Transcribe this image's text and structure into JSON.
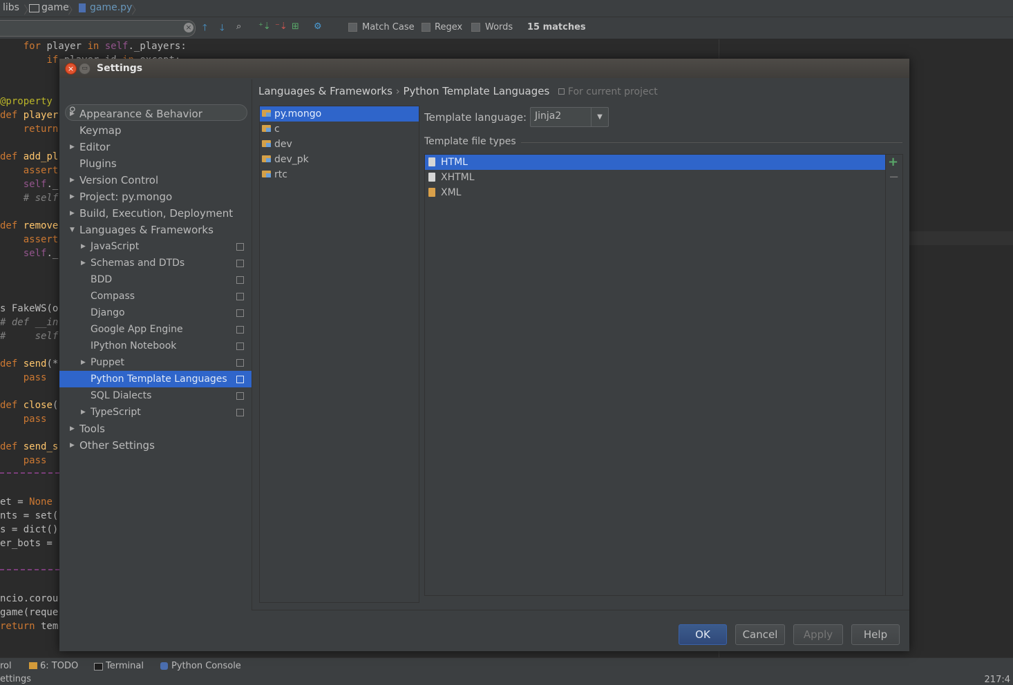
{
  "navbar": {
    "crumbs": [
      "libs",
      "game",
      "game.py"
    ]
  },
  "findbar": {
    "match_case": "Match Case",
    "regex": "Regex",
    "words": "Words",
    "matches": "15 matches"
  },
  "editor": {
    "lines": [
      {
        "t": "    for player in self._players:"
      },
      {
        "t": "        if player_id in except:"
      },
      {
        "t": "@property"
      },
      {
        "t": "def player"
      },
      {
        "t": "    return"
      },
      {
        "t": "def add_pl"
      },
      {
        "t": "    assert"
      },
      {
        "t": "    self._"
      },
      {
        "t": "    # self"
      },
      {
        "t": "def remove"
      },
      {
        "t": "    assert"
      },
      {
        "t": "    self._"
      },
      {
        "t": "s FakeWS(o"
      },
      {
        "t": "# def __in"
      },
      {
        "t": "#     self"
      },
      {
        "t": "def send(*"
      },
      {
        "t": "    pass"
      },
      {
        "t": "def close("
      },
      {
        "t": "    pass"
      },
      {
        "t": "def send_s"
      },
      {
        "t": "    pass"
      },
      {
        "t": "et = None"
      },
      {
        "t": "nts = set("
      },
      {
        "t": "s = dict()"
      },
      {
        "t": "er_bots ="
      },
      {
        "t": "ncio.corou"
      },
      {
        "t": "game(reque"
      },
      {
        "t": "return tem"
      }
    ]
  },
  "toolwindows": {
    "control": "rol",
    "todo": "6: TODO",
    "terminal": "Terminal",
    "python_console": "Python Console"
  },
  "status": {
    "left": "ettings",
    "right": "217:4"
  },
  "dialog": {
    "title": "Settings",
    "close_glyph": "×",
    "tree": [
      {
        "label": "Appearance & Behavior",
        "level": 0,
        "arrow": "▶"
      },
      {
        "label": "Keymap",
        "level": 0,
        "arrow": ""
      },
      {
        "label": "Editor",
        "level": 0,
        "arrow": "▶"
      },
      {
        "label": "Plugins",
        "level": 0,
        "arrow": ""
      },
      {
        "label": "Version Control",
        "level": 0,
        "arrow": "▶"
      },
      {
        "label": "Project: py.mongo",
        "level": 0,
        "arrow": "▶"
      },
      {
        "label": "Build, Execution, Deployment",
        "level": 0,
        "arrow": "▶"
      },
      {
        "label": "Languages & Frameworks",
        "level": 0,
        "arrow": "▼"
      },
      {
        "label": "JavaScript",
        "level": 1,
        "arrow": "▶",
        "proj": true
      },
      {
        "label": "Schemas and DTDs",
        "level": 1,
        "arrow": "▶",
        "proj": true
      },
      {
        "label": "BDD",
        "level": 1,
        "arrow": "",
        "proj": true
      },
      {
        "label": "Compass",
        "level": 1,
        "arrow": "",
        "proj": true
      },
      {
        "label": "Django",
        "level": 1,
        "arrow": "",
        "proj": true
      },
      {
        "label": "Google App Engine",
        "level": 1,
        "arrow": "",
        "proj": true
      },
      {
        "label": "IPython Notebook",
        "level": 1,
        "arrow": "",
        "proj": true
      },
      {
        "label": "Puppet",
        "level": 1,
        "arrow": "▶",
        "proj": true
      },
      {
        "label": "Python Template Languages",
        "level": 1,
        "arrow": "",
        "proj": true,
        "selected": true
      },
      {
        "label": "SQL Dialects",
        "level": 1,
        "arrow": "",
        "proj": true
      },
      {
        "label": "TypeScript",
        "level": 1,
        "arrow": "▶",
        "proj": true
      },
      {
        "label": "Tools",
        "level": 0,
        "arrow": "▶"
      },
      {
        "label": "Other Settings",
        "level": 0,
        "arrow": "▶"
      }
    ],
    "breadcrumb": {
      "parent": "Languages & Frameworks",
      "sep": "›",
      "current": "Python Template Languages",
      "scope": "For current project"
    },
    "projects": [
      {
        "label": "py.mongo",
        "selected": true
      },
      {
        "label": "c"
      },
      {
        "label": "dev"
      },
      {
        "label": "dev_pk"
      },
      {
        "label": "rtc"
      }
    ],
    "template_language": {
      "label": "Template language:",
      "value": "Jinja2"
    },
    "template_file_types": {
      "label": "Template file types",
      "items": [
        {
          "label": "HTML",
          "selected": true,
          "icon": "html-file-icon"
        },
        {
          "label": "XHTML",
          "icon": "xhtml-file-icon"
        },
        {
          "label": "XML",
          "icon": "xml-file-icon"
        }
      ]
    },
    "buttons": {
      "ok": "OK",
      "cancel": "Cancel",
      "apply": "Apply",
      "help": "Help"
    },
    "colors": {
      "selection": "#2f65ca",
      "dialog_bg": "#3c3f41",
      "editor_bg": "#2b2b2b",
      "add_green": "#59a869"
    }
  }
}
